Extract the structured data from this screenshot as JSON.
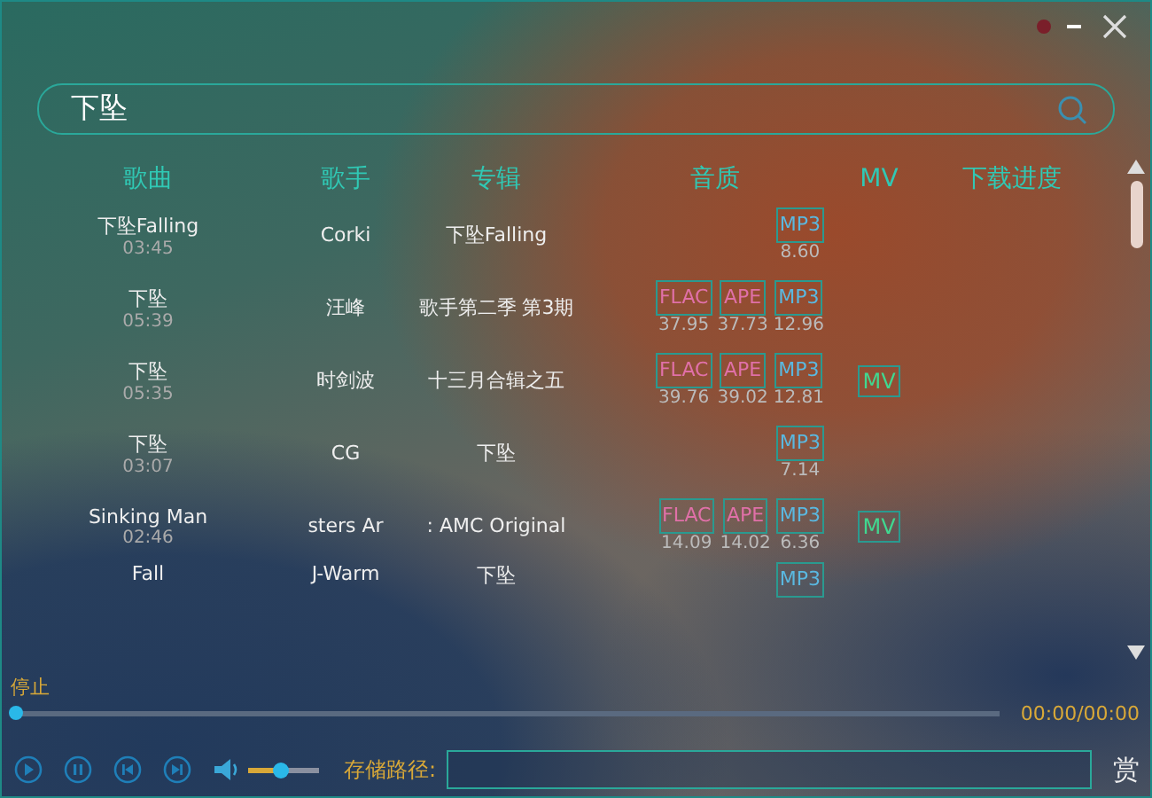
{
  "search": {
    "value": "下坠"
  },
  "columns": [
    "歌曲",
    "歌手",
    "专辑",
    "音质",
    "MV",
    "下载进度"
  ],
  "rows": [
    {
      "title": "下坠Falling",
      "duration": "03:45",
      "artist": "Corki",
      "album": "下坠Falling",
      "qualities": [
        {
          "kind": "mp3",
          "label": "MP3",
          "size": "8.60"
        }
      ],
      "mv": ""
    },
    {
      "title": "下坠",
      "duration": "05:39",
      "artist": "汪峰",
      "album": "歌手第二季 第3期",
      "qualities": [
        {
          "kind": "flac",
          "label": "FLAC",
          "size": "37.95"
        },
        {
          "kind": "ape",
          "label": "APE",
          "size": "37.73"
        },
        {
          "kind": "mp3",
          "label": "MP3",
          "size": "12.96"
        }
      ],
      "mv": ""
    },
    {
      "title": "下坠",
      "duration": "05:35",
      "artist": "时剑波",
      "album": "十三月合辑之五",
      "qualities": [
        {
          "kind": "flac",
          "label": "FLAC",
          "size": "39.76"
        },
        {
          "kind": "ape",
          "label": "APE",
          "size": "39.02"
        },
        {
          "kind": "mp3",
          "label": "MP3",
          "size": "12.81"
        }
      ],
      "mv": "MV"
    },
    {
      "title": "下坠",
      "duration": "03:07",
      "artist": "CG",
      "album": "下坠",
      "qualities": [
        {
          "kind": "mp3",
          "label": "MP3",
          "size": "7.14"
        }
      ],
      "mv": ""
    },
    {
      "title": "Sinking Man",
      "duration": "02:46",
      "artist": "sters Ar",
      "album": ": AMC Original",
      "qualities": [
        {
          "kind": "flac",
          "label": "FLAC",
          "size": "14.09"
        },
        {
          "kind": "ape",
          "label": "APE",
          "size": "14.02"
        },
        {
          "kind": "mp3",
          "label": "MP3",
          "size": "6.36"
        }
      ],
      "mv": "MV"
    },
    {
      "title": "Fall",
      "artist": "J-Warm",
      "album": "下坠",
      "qualities": [
        {
          "kind": "mp3",
          "label": "MP3"
        }
      ],
      "mv": ""
    }
  ],
  "player": {
    "status": "停止",
    "progress": {
      "level": 0
    },
    "time": "00:00/00:00",
    "volume": {
      "level": 0.45
    },
    "save_path_label": "存储路径:",
    "reward": "赏"
  }
}
